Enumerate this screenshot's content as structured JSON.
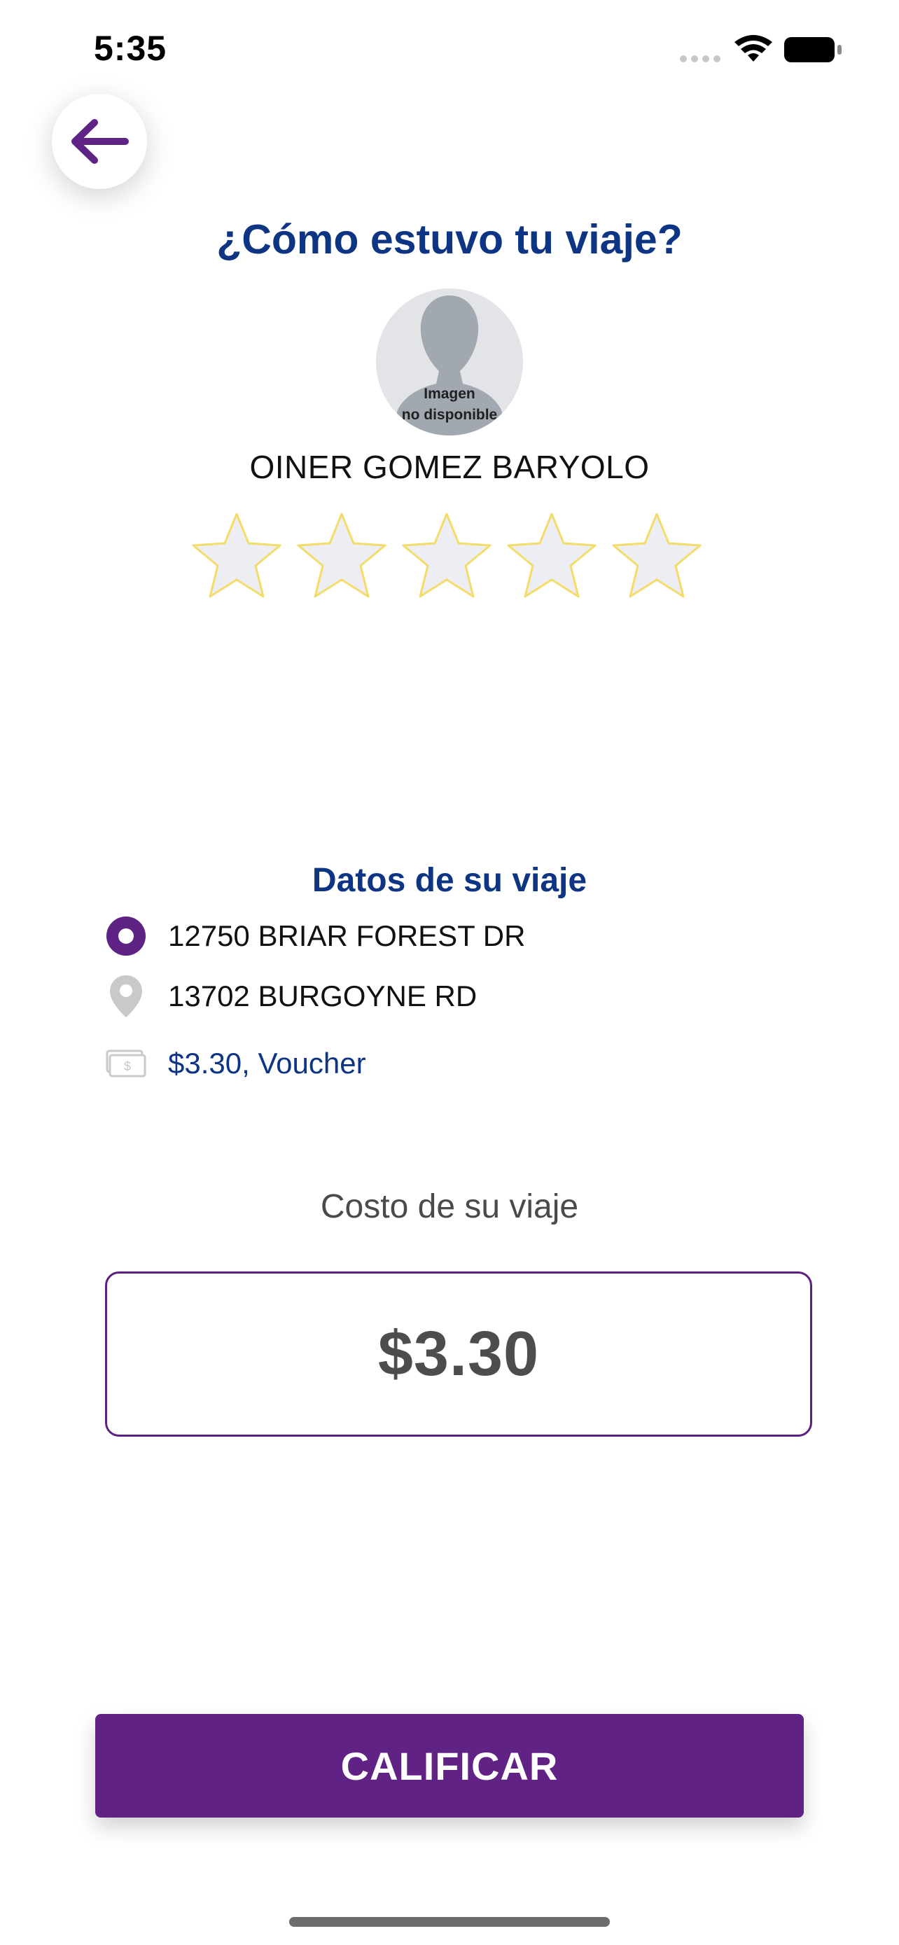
{
  "status_bar": {
    "time": "5:35"
  },
  "header": {
    "title": "¿Cómo estuvo tu viaje?"
  },
  "driver": {
    "avatar_caption_line1": "Imagen",
    "avatar_caption_line2": "no disponible",
    "name": "OINER GOMEZ BARYOLO"
  },
  "rating": {
    "max_stars": 5,
    "selected": 0
  },
  "trip": {
    "section_title": "Datos de su viaje",
    "origin": "12750 BRIAR FOREST DR",
    "destination": "13702 BURGOYNE RD",
    "payment": "$3.30, Voucher"
  },
  "cost": {
    "label": "Costo de su viaje",
    "value": "$3.30"
  },
  "actions": {
    "rate_label": "CALIFICAR"
  },
  "colors": {
    "brand_purple": "#612286",
    "title_blue": "#0d3583",
    "star_fill": "#eceef3",
    "star_stroke": "#f4dc6a"
  },
  "icons": {
    "back": "arrow-left-icon",
    "origin": "origin-radio-icon",
    "destination": "map-pin-icon",
    "payment": "cash-icon",
    "star": "star-icon"
  }
}
